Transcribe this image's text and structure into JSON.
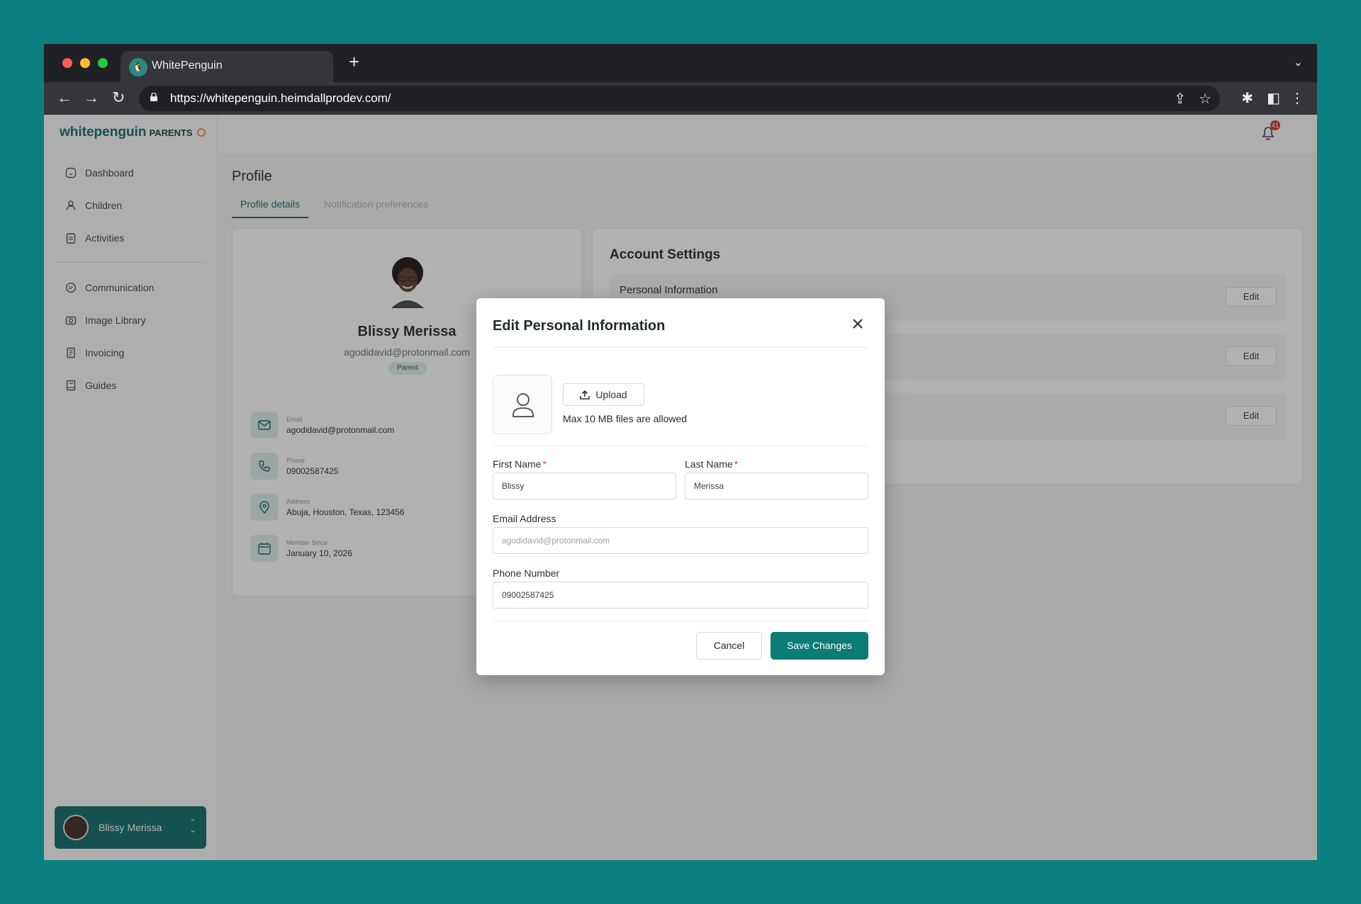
{
  "browser": {
    "tab_title": "WhitePenguin",
    "url": "https://whitepenguin.heimdallprodev.com/"
  },
  "app": {
    "brand_name": "whitepenguin",
    "brand_sub": "PARENTS",
    "notification_count": "41",
    "sidebar": {
      "items": [
        {
          "label": "Dashboard",
          "icon": "home-icon"
        },
        {
          "label": "Children",
          "icon": "children-icon"
        },
        {
          "label": "Activities",
          "icon": "clipboard-icon"
        },
        {
          "label": "Communication",
          "icon": "chat-icon"
        },
        {
          "label": "Image Library",
          "icon": "camera-icon"
        },
        {
          "label": "Invoicing",
          "icon": "invoice-icon"
        },
        {
          "label": "Guides",
          "icon": "book-icon"
        }
      ],
      "user_name": "Blissy Merissa"
    },
    "page_title": "Profile",
    "tabs": [
      "Profile details",
      "Notification preferences"
    ],
    "profile": {
      "name": "Blissy Merissa",
      "email": "agodidavid@protonmail.com",
      "role": "Parent",
      "details": [
        {
          "label": "Email",
          "value": "agodidavid@protonmail.com"
        },
        {
          "label": "Phone",
          "value": "09002587425"
        },
        {
          "label": "Address",
          "value": "Abuja, Houston, Texas, 123456"
        },
        {
          "label": "Member Since",
          "value": "January 10, 2026"
        }
      ]
    },
    "account_settings": {
      "title": "Account Settings",
      "rows": [
        {
          "title": "Personal Information",
          "edit_label": "Edit"
        },
        {
          "title": "",
          "edit_label": "Edit"
        },
        {
          "title": "",
          "edit_label": "Edit"
        }
      ]
    }
  },
  "modal": {
    "title": "Edit Personal Information",
    "upload_label": "Upload",
    "upload_hint": "Max 10 MB files are allowed",
    "first_name_label": "First Name",
    "first_name_value": "Blissy",
    "last_name_label": "Last Name",
    "last_name_value": "Merissa",
    "email_label": "Email Address",
    "email_value": "agodidavid@protonmail.com",
    "phone_label": "Phone Number",
    "phone_value": "09002587425",
    "required_mark": "*",
    "cancel_label": "Cancel",
    "save_label": "Save Changes",
    "accent_color": "#0b7b76"
  }
}
